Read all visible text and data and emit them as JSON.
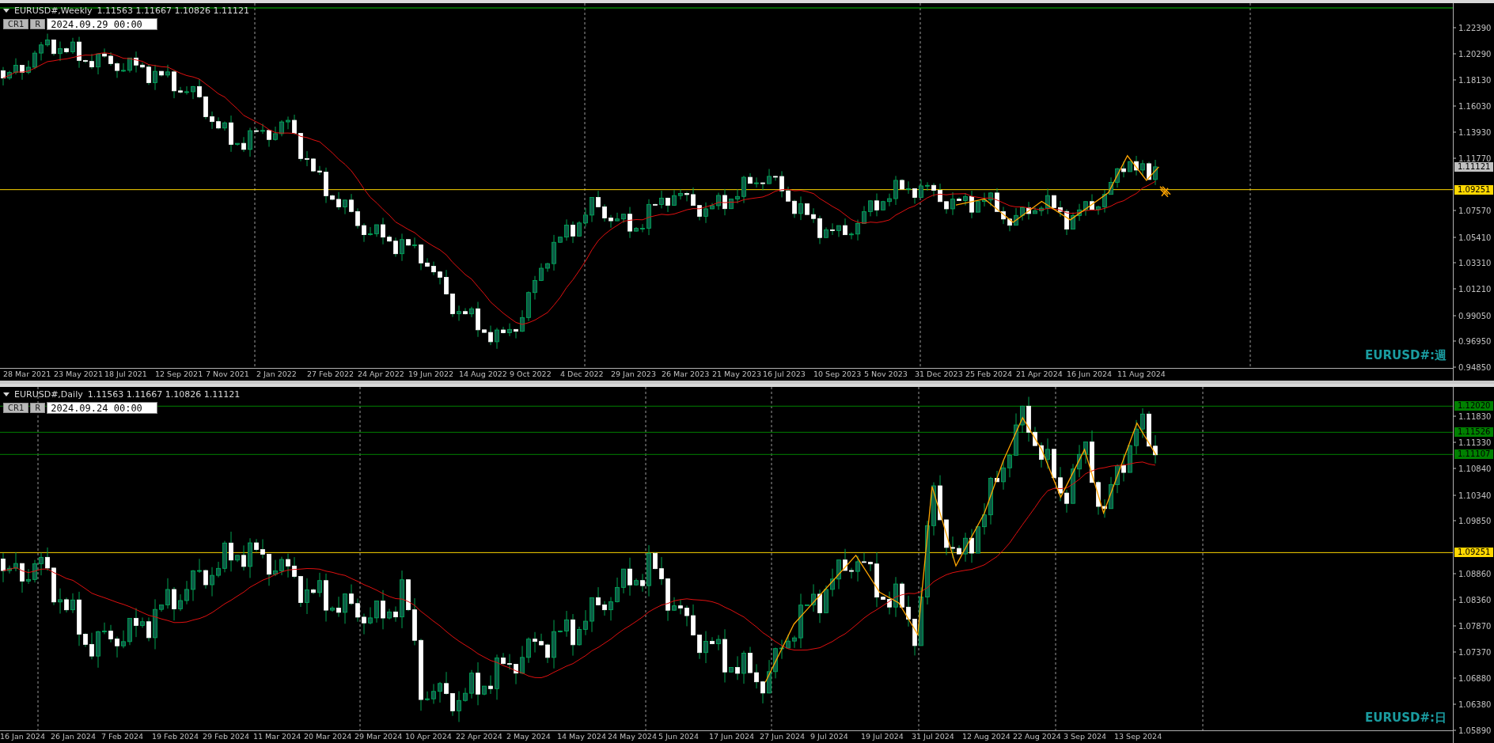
{
  "charts": [
    {
      "symbol": "EURUSD#,Weekly",
      "ohlc": "1.11563 1.11667 1.10826 1.11121",
      "buttons": [
        "CR1",
        "R"
      ],
      "time_field": "2024.09.29 00:00",
      "label": "EURUSD#:週",
      "price_ticks": [
        "1.22390",
        "1.20290",
        "1.18130",
        "1.16030",
        "1.13930",
        "1.11770",
        "1.07570",
        "1.05410",
        "1.03310",
        "1.01210",
        "0.99050",
        "0.96950",
        "0.94850"
      ],
      "price_markers": [
        {
          "price": "1.11121",
          "kind": "label",
          "color": "#c0c0c0"
        },
        {
          "price": "1.09251",
          "kind": "line",
          "color": "#ffd700"
        }
      ],
      "date_labels": [
        "28 Mar 2021",
        "23 May 2021",
        "18 Jul 2021",
        "12 Sep 2021",
        "7 Nov 2021",
        "2 Jan 2022",
        "27 Feb 2022",
        "24 Apr 2022",
        "19 Jun 2022",
        "14 Aug 2022",
        "9 Oct 2022",
        "4 Dec 2022",
        "29 Jan 2023",
        "26 Mar 2023",
        "21 May 2023",
        "16 Jul 2023",
        "10 Sep 2023",
        "5 Nov 2023",
        "31 Dec 2023",
        "25 Feb 2024",
        "21 Apr 2024",
        "16 Jun 2024",
        "11 Aug 2024"
      ]
    },
    {
      "symbol": "EURUSD#,Daily",
      "ohlc": "1.11563 1.11667 1.10826 1.11121",
      "buttons": [
        "CR1",
        "R"
      ],
      "time_field": "2024.09.24 00:00",
      "label": "EURUSD#:日",
      "price_ticks": [
        "1.11830",
        "1.11330",
        "1.10840",
        "1.10340",
        "1.09850",
        "1.08860",
        "1.08360",
        "1.07870",
        "1.07370",
        "1.06880",
        "1.06380",
        "1.05890"
      ],
      "price_markers": [
        {
          "price": "1.12020",
          "kind": "line",
          "color": "#008000"
        },
        {
          "price": "1.11526",
          "kind": "line",
          "color": "#008000"
        },
        {
          "price": "1.11107",
          "kind": "line",
          "color": "#008000"
        },
        {
          "price": "1.09251",
          "kind": "line",
          "color": "#ffd700"
        }
      ],
      "date_labels": [
        "16 Jan 2024",
        "26 Jan 2024",
        "7 Feb 2024",
        "19 Feb 2024",
        "29 Feb 2024",
        "11 Mar 2024",
        "20 Mar 2024",
        "29 Mar 2024",
        "10 Apr 2024",
        "22 Apr 2024",
        "2 May 2024",
        "14 May 2024",
        "24 May 2024",
        "5 Jun 2024",
        "17 Jun 2024",
        "27 Jun 2024",
        "9 Jul 2024",
        "19 Jul 2024",
        "31 Jul 2024",
        "12 Aug 2024",
        "22 Aug 2024",
        "3 Sep 2024",
        "13 Sep 2024"
      ]
    }
  ]
}
